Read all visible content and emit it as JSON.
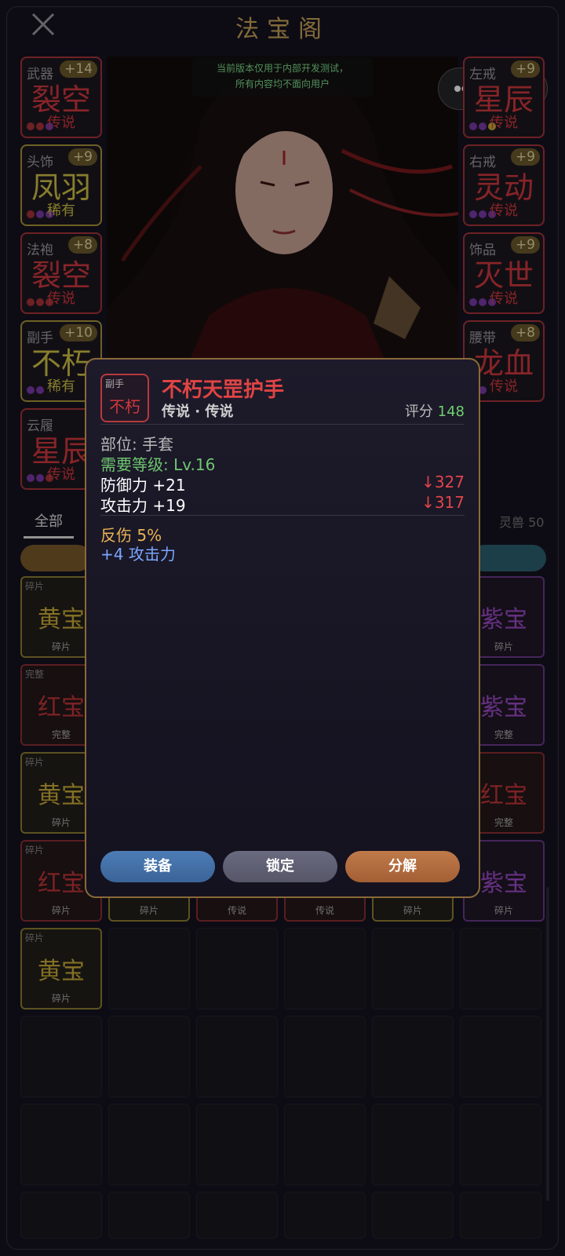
{
  "header": {
    "title": "法宝阁",
    "close_icon": "close-icon"
  },
  "notice": {
    "line1": "当前版本仅用于内部开发测试，",
    "line2": "所有内容均不面向用户"
  },
  "capsule": {
    "more_icon": "more-dots-icon",
    "target_icon": "target-circle-icon"
  },
  "equipment_left": [
    {
      "label": "武器",
      "plus": "+14",
      "name": "裂空",
      "grade": "传说",
      "kind": "legend"
    },
    {
      "label": "头饰",
      "plus": "+9",
      "name": "凤羽",
      "grade": "稀有",
      "kind": "rare"
    },
    {
      "label": "法袍",
      "plus": "+8",
      "name": "裂空",
      "grade": "传说",
      "kind": "legend"
    },
    {
      "label": "副手",
      "plus": "+10",
      "name": "不朽",
      "grade": "稀有",
      "kind": "rare"
    },
    {
      "label": "云履",
      "plus": "",
      "name": "星辰",
      "grade": "传说",
      "kind": "legend"
    }
  ],
  "equipment_right": [
    {
      "label": "左戒",
      "plus": "+9",
      "name": "星辰",
      "grade": "传说",
      "kind": "legend"
    },
    {
      "label": "右戒",
      "plus": "+9",
      "name": "灵动",
      "grade": "传说",
      "kind": "legend"
    },
    {
      "label": "饰品",
      "plus": "+9",
      "name": "灭世",
      "grade": "传说",
      "kind": "legend"
    },
    {
      "label": "腰带",
      "plus": "+8",
      "name": "龙血",
      "grade": "传说",
      "kind": "legend"
    }
  ],
  "tabs": {
    "all": "全部",
    "right_label": "灵兽",
    "right_count": "50"
  },
  "inventory_left": [
    {
      "tag": "碎片",
      "name": "黄宝",
      "sub": "碎片",
      "kind": "yellow"
    },
    {
      "tag": "完整",
      "name": "红宝",
      "sub": "完整",
      "kind": "red"
    },
    {
      "tag": "碎片",
      "name": "黄宝",
      "sub": "碎片",
      "kind": "yellow"
    },
    {
      "tag": "碎片",
      "name": "红宝",
      "sub": "碎片",
      "kind": "red"
    },
    {
      "tag": "碎片",
      "name": "黄宝",
      "sub": "碎片",
      "kind": "yellow"
    }
  ],
  "inventory_right": [
    {
      "tag": "",
      "name": "紫宝",
      "sub": "碎片",
      "kind": "purple"
    },
    {
      "tag": "",
      "name": "紫宝",
      "sub": "完整",
      "kind": "purple"
    },
    {
      "tag": "",
      "name": "红宝",
      "sub": "完整",
      "kind": "red"
    },
    {
      "tag": "",
      "name": "紫宝",
      "sub": "碎片",
      "kind": "purple"
    }
  ],
  "inventory_row4_mid": [
    {
      "sub": "碎片",
      "kind": "yellow"
    },
    {
      "sub": "传说",
      "kind": "red"
    },
    {
      "sub": "传说",
      "kind": "red"
    },
    {
      "sub": "碎片",
      "kind": "yellow"
    }
  ],
  "popup": {
    "icon_small": "副手",
    "icon_big": "不朽",
    "name": "不朽天罡护手",
    "grade": "传说 · 传说",
    "score_label": "评分",
    "score": "148",
    "slot_type": "部位: 手套",
    "req_level": "需要等级: Lv.16",
    "def": "防御力 +21",
    "def_cmp": "↓327",
    "atk": "攻击力 +19",
    "atk_cmp": "↓317",
    "reflect": "反伤 5%",
    "bonus": "+4 攻击力",
    "buttons": {
      "equip": "装备",
      "lock": "锁定",
      "decompose": "分解"
    }
  },
  "colors": {
    "legend": "#d0383e",
    "rare": "#cfc245",
    "accent": "#c9a45a",
    "green": "#6ed06e"
  }
}
